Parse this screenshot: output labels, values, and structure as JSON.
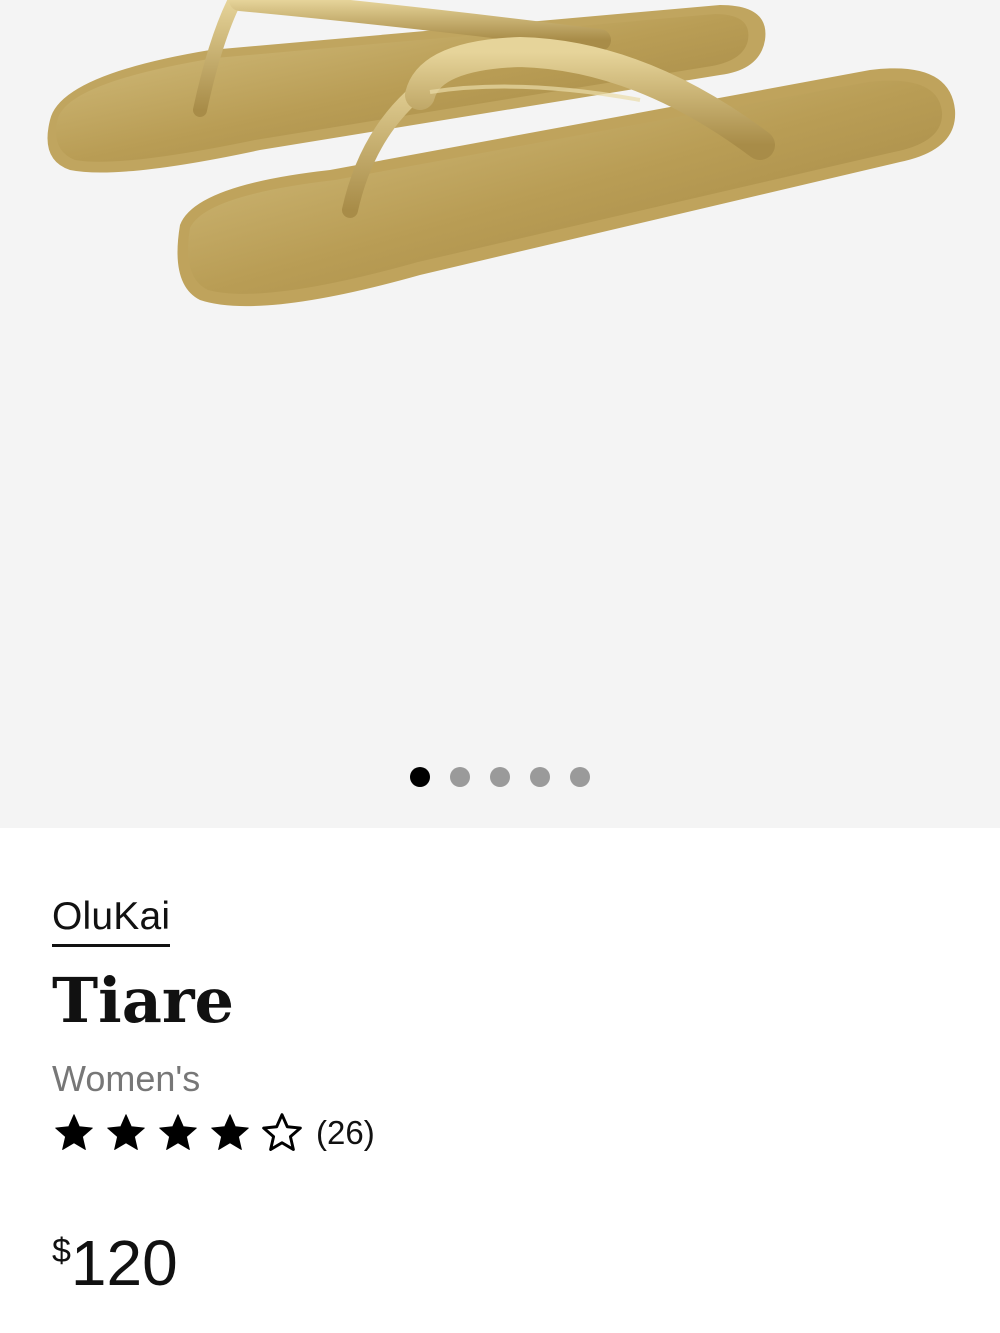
{
  "product": {
    "brand": "OluKai",
    "name": "Tiare",
    "gender": "Women's",
    "rating": 4,
    "rating_max": 5,
    "review_count": "(26)",
    "price_currency": "$",
    "price_amount": "120"
  },
  "gallery": {
    "image_count": 5,
    "active_index": 0,
    "colors": {
      "background": "#f4f4f4",
      "active_dot": "#000000",
      "inactive_dot": "#9a9a9a",
      "metal_gold": "#c9b06a"
    }
  },
  "icons": {
    "star_filled": "star-filled-icon",
    "star_empty": "star-outline-icon"
  }
}
